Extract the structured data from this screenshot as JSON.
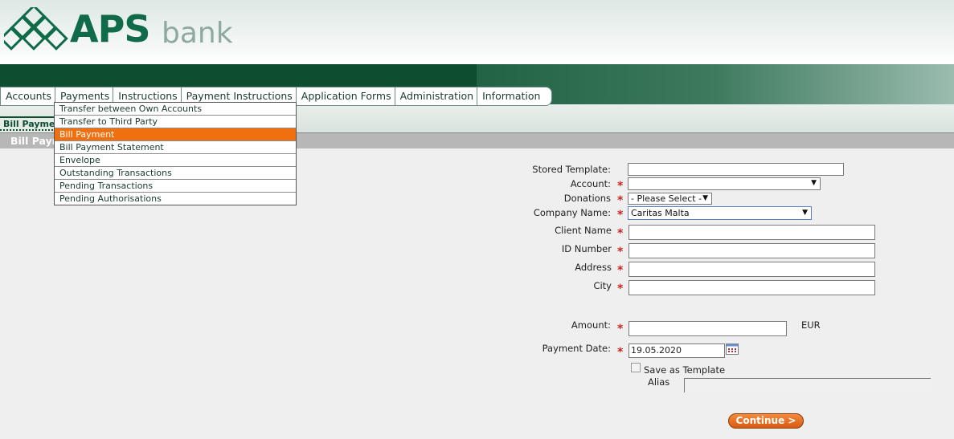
{
  "brand": {
    "name_bold": "APS",
    "name_light": "bank"
  },
  "nav": {
    "items": [
      "Accounts",
      "Payments",
      "Instructions",
      "Payment Instructions",
      "Application Forms",
      "Administration",
      "Information"
    ]
  },
  "subtab": {
    "label": "Bill Payme"
  },
  "page_title": "Bill Paym",
  "dropdown": {
    "items": [
      {
        "label": "Transfer between Own Accounts",
        "active": false
      },
      {
        "label": "Transfer to Third Party",
        "active": false
      },
      {
        "label": "Bill Payment",
        "active": true
      },
      {
        "label": "Bill Payment Statement",
        "active": false
      },
      {
        "label": "Envelope",
        "active": false
      },
      {
        "label": "Outstanding Transactions",
        "active": false
      },
      {
        "label": "Pending Transactions",
        "active": false
      },
      {
        "label": "Pending Authorisations",
        "active": false
      }
    ]
  },
  "form": {
    "stored_template_label": "Stored Template:",
    "stored_template_value": "",
    "account_label": "Account:",
    "account_value": "",
    "donations_label": "Donations",
    "donations_value": "- Please Select -",
    "company_label": "Company Name:",
    "company_value": "Caritas Malta",
    "client_name_label": "Client Name",
    "client_name_value": "",
    "id_number_label": "ID Number",
    "id_number_value": "",
    "address_label": "Address",
    "address_value": "",
    "city_label": "City",
    "city_value": "",
    "amount_label": "Amount:",
    "amount_value": "",
    "currency": "EUR",
    "payment_date_label": "Payment Date:",
    "payment_date_value": "19.05.2020",
    "save_template_label": "Save as Template",
    "save_template_checked": false,
    "alias_label": "Alias",
    "alias_value": "",
    "required_marker": "*",
    "continue_label": "Continue >"
  },
  "colors": {
    "brand_green": "#0f6b49",
    "dark_green": "#0e4d30",
    "menu_active": "#f07010",
    "required": "#d02020",
    "button_orange": "#e46a1f"
  },
  "icons": [
    "logo-diamond-icon",
    "dropdown-arrow-icon",
    "calendar-icon"
  ]
}
